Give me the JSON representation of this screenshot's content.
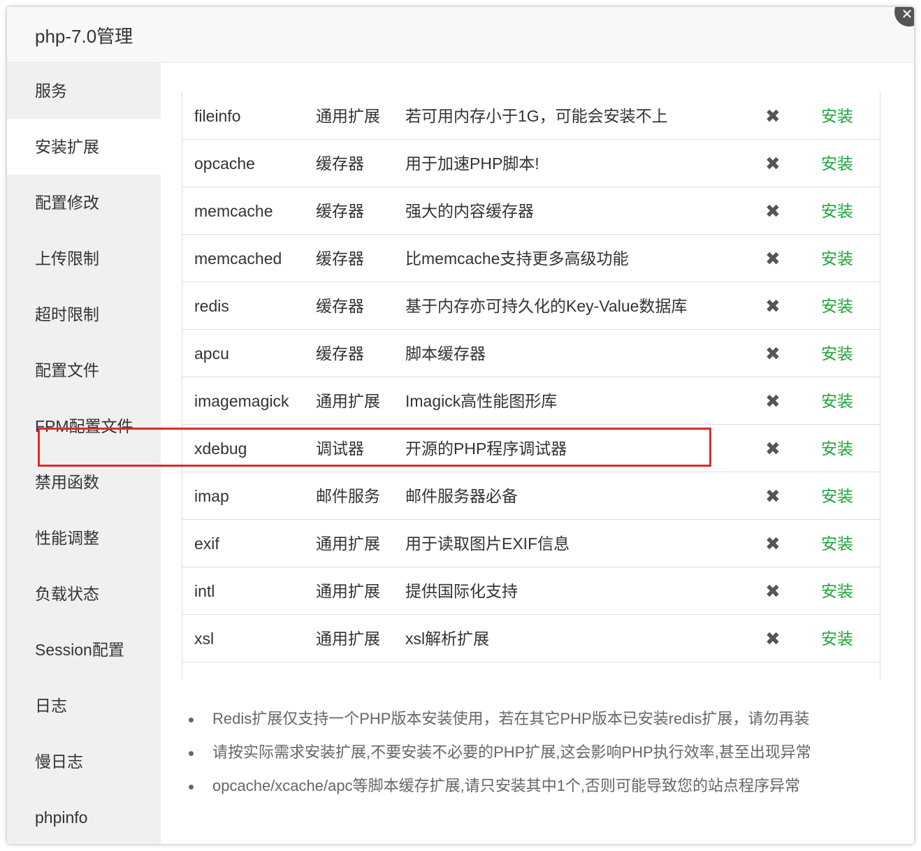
{
  "window": {
    "title": "php-7.0管理",
    "close_icon": "✕"
  },
  "sidebar": {
    "items": [
      {
        "label": "服务"
      },
      {
        "label": "安装扩展",
        "active": true
      },
      {
        "label": "配置修改"
      },
      {
        "label": "上传限制"
      },
      {
        "label": "超时限制"
      },
      {
        "label": "配置文件"
      },
      {
        "label": "FPM配置文件"
      },
      {
        "label": "禁用函数"
      },
      {
        "label": "性能调整"
      },
      {
        "label": "负载状态"
      },
      {
        "label": "Session配置"
      },
      {
        "label": "日志"
      },
      {
        "label": "慢日志"
      },
      {
        "label": "phpinfo"
      }
    ]
  },
  "extensions": {
    "status_icon": "✖",
    "rows": [
      {
        "name": "fileinfo",
        "type": "通用扩展",
        "desc": "若可用内存小于1G，可能会安装不上",
        "action": "安装"
      },
      {
        "name": "opcache",
        "type": "缓存器",
        "desc": "用于加速PHP脚本!",
        "action": "安装"
      },
      {
        "name": "memcache",
        "type": "缓存器",
        "desc": "强大的内容缓存器",
        "action": "安装"
      },
      {
        "name": "memcached",
        "type": "缓存器",
        "desc": "比memcache支持更多高级功能",
        "action": "安装"
      },
      {
        "name": "redis",
        "type": "缓存器",
        "desc": "基于内存亦可持久化的Key-Value数据库",
        "action": "安装"
      },
      {
        "name": "apcu",
        "type": "缓存器",
        "desc": "脚本缓存器",
        "action": "安装"
      },
      {
        "name": "imagemagick",
        "type": "通用扩展",
        "desc": "Imagick高性能图形库",
        "action": "安装"
      },
      {
        "name": "xdebug",
        "type": "调试器",
        "desc": "开源的PHP程序调试器",
        "action": "安装"
      },
      {
        "name": "imap",
        "type": "邮件服务",
        "desc": "邮件服务器必备",
        "action": "安装"
      },
      {
        "name": "exif",
        "type": "通用扩展",
        "desc": "用于读取图片EXIF信息",
        "action": "安装"
      },
      {
        "name": "intl",
        "type": "通用扩展",
        "desc": "提供国际化支持",
        "action": "安装"
      },
      {
        "name": "xsl",
        "type": "通用扩展",
        "desc": "xsl解析扩展",
        "action": "安装"
      }
    ]
  },
  "notes": [
    "Redis扩展仅支持一个PHP版本安装使用，若在其它PHP版本已安装redis扩展，请勿再装",
    "请按实际需求安装扩展,不要安装不必要的PHP扩展,这会影响PHP执行效率,甚至出现异常",
    "opcache/xcache/apc等脚本缓存扩展,请只安装其中1个,否则可能导致您的站点程序异常"
  ],
  "colors": {
    "install_green": "#20a53a",
    "highlight_red": "#e02b27"
  }
}
